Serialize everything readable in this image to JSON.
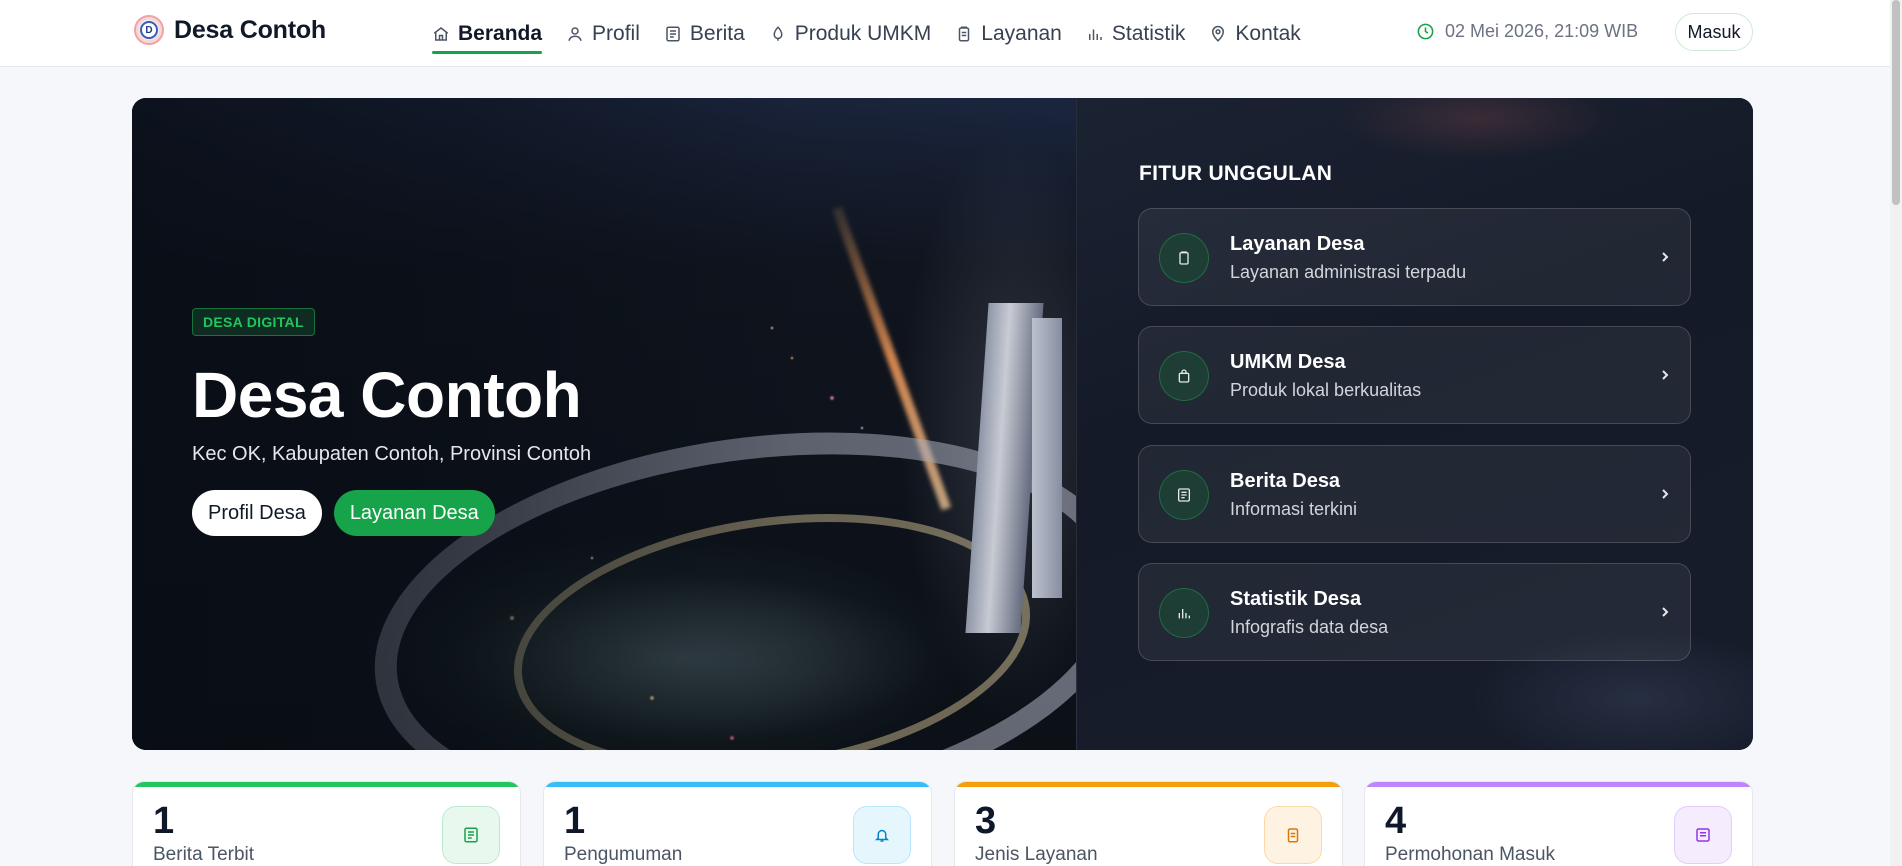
{
  "brand": {
    "name": "Desa Contoh",
    "logo_letter": "D"
  },
  "nav": {
    "items": [
      {
        "label": "Beranda",
        "icon": "home-icon",
        "active": true
      },
      {
        "label": "Profil",
        "icon": "user-icon"
      },
      {
        "label": "Berita",
        "icon": "newspaper-icon"
      },
      {
        "label": "Produk UMKM",
        "icon": "tag-icon"
      },
      {
        "label": "Layanan",
        "icon": "clipboard-icon"
      },
      {
        "label": "Statistik",
        "icon": "bar-chart-icon"
      },
      {
        "label": "Kontak",
        "icon": "map-pin-icon"
      }
    ]
  },
  "header": {
    "datetime": "02 Mei 2026, 21:09 WIB",
    "login_label": "Masuk"
  },
  "hero": {
    "badge": "DESA DIGITAL",
    "title": "Desa Contoh",
    "subtitle": "Kec OK, Kabupaten Contoh, Provinsi Contoh",
    "primary_button": "Profil Desa",
    "secondary_button": "Layanan Desa"
  },
  "features": {
    "title": "FITUR UNGGULAN",
    "items": [
      {
        "name": "Layanan Desa",
        "desc": "Layanan administrasi terpadu",
        "icon": "clipboard-icon"
      },
      {
        "name": "UMKM Desa",
        "desc": "Produk lokal berkualitas",
        "icon": "shopping-bag-icon"
      },
      {
        "name": "Berita Desa",
        "desc": "Informasi terkini",
        "icon": "newspaper-icon"
      },
      {
        "name": "Statistik Desa",
        "desc": "Infografis data desa",
        "icon": "bar-chart-icon"
      }
    ]
  },
  "stats": [
    {
      "value": "1",
      "label": "Berita Terbit",
      "color": "#22c55e",
      "icon": "newspaper-icon"
    },
    {
      "value": "1",
      "label": "Pengumuman",
      "color": "#38bdf8",
      "icon": "bell-icon"
    },
    {
      "value": "3",
      "label": "Jenis Layanan",
      "color": "#f59e0b",
      "icon": "clipboard-icon"
    },
    {
      "value": "4",
      "label": "Permohonan Masuk",
      "color": "#c084fc",
      "icon": "inbox-icon"
    }
  ],
  "colors": {
    "accent": "#16a34a",
    "hero_bg": "#0d1320"
  }
}
